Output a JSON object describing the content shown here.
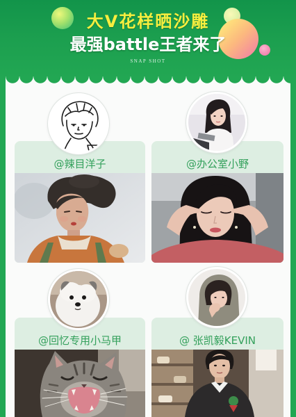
{
  "header": {
    "title": "大V花样晒沙雕",
    "subtitle": "最强battle王者来了",
    "tagline": "SNAP SHOT"
  },
  "colors": {
    "brand_green": "#22a753",
    "title_yellow": "#f6ee3f",
    "card_bg": "#ddeee2",
    "name_green": "#33a05b",
    "panel_bg": "#fafbfa"
  },
  "cards": [
    {
      "name": "@辣目洋子"
    },
    {
      "name": "@办公室小野"
    },
    {
      "name": "@回忆专用小马甲"
    },
    {
      "name": "@ 张凯毅KEVIN"
    }
  ]
}
